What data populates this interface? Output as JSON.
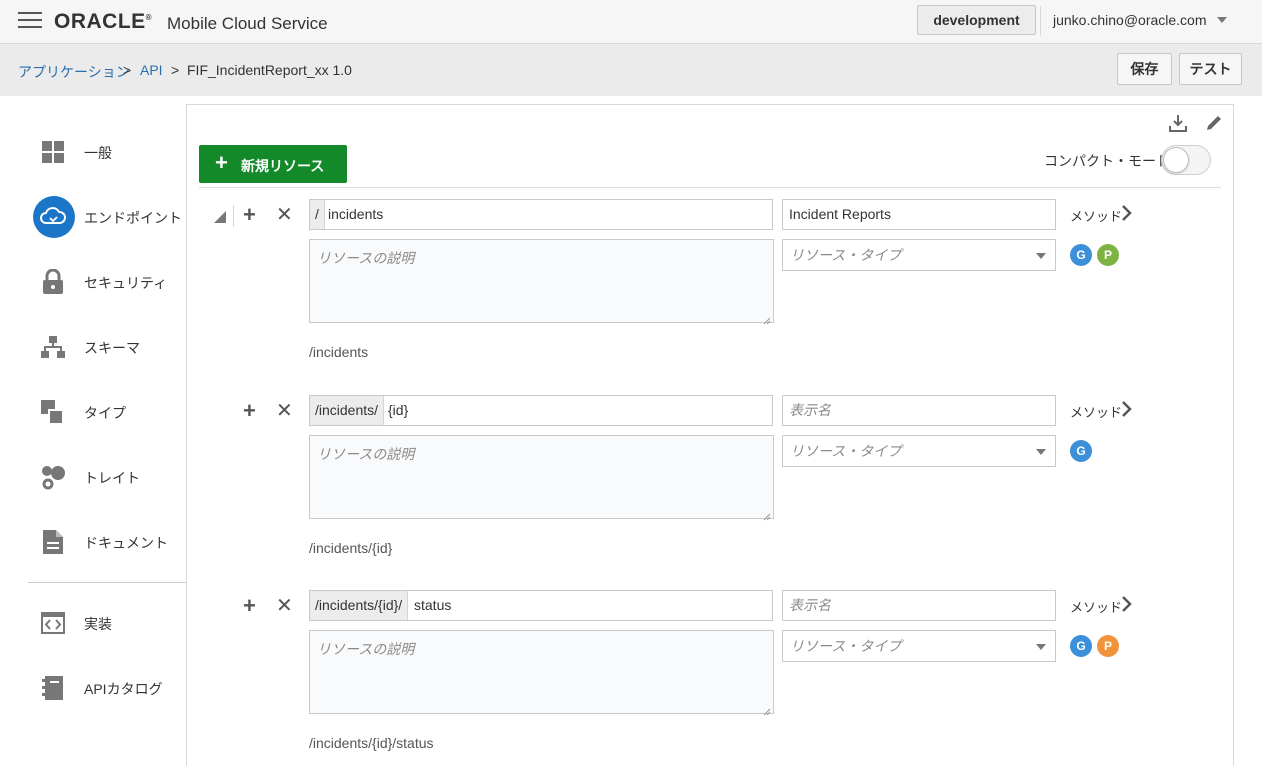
{
  "header": {
    "logo": "ORACLE",
    "product": "Mobile Cloud Service",
    "environment": "development",
    "user": "junko.chino@oracle.com"
  },
  "breadcrumb": {
    "items": [
      "アプリケーション",
      "API",
      "FIF_IncidentReport_xx 1.0"
    ],
    "separator": ">"
  },
  "actions": {
    "save": "保存",
    "test": "テスト"
  },
  "sidebar": {
    "items": [
      {
        "label": "一般",
        "icon": "grid-icon"
      },
      {
        "label": "エンドポイント",
        "icon": "cloud-endpoint-icon",
        "active": true
      },
      {
        "label": "セキュリティ",
        "icon": "lock-icon"
      },
      {
        "label": "スキーマ",
        "icon": "hierarchy-icon"
      },
      {
        "label": "タイプ",
        "icon": "types-icon"
      },
      {
        "label": "トレイト",
        "icon": "traits-icon"
      },
      {
        "label": "ドキュメント",
        "icon": "document-icon"
      },
      {
        "label": "実装",
        "icon": "code-icon"
      },
      {
        "label": "APIカタログ",
        "icon": "catalog-icon"
      }
    ]
  },
  "toolbar": {
    "new_resource": "新規リソース",
    "compact_mode": "コンパクト・モード",
    "compact_mode_on": false
  },
  "resources": [
    {
      "prefix": "/",
      "path": "incidents",
      "display_name": "Incident Reports",
      "display_name_placeholder": "表示名",
      "description_placeholder": "リソースの説明",
      "type_placeholder": "リソース・タイプ",
      "methods_label": "メソッド",
      "full_path": "/incidents",
      "method_badges": [
        {
          "letter": "G",
          "color": "#3c8fd9"
        },
        {
          "letter": "P",
          "color": "#7cb342"
        }
      ]
    },
    {
      "prefix": "/incidents/",
      "path": "{id}",
      "display_name": "",
      "display_name_placeholder": "表示名",
      "description_placeholder": "リソースの説明",
      "type_placeholder": "リソース・タイプ",
      "methods_label": "メソッド",
      "full_path": "/incidents/{id}",
      "method_badges": [
        {
          "letter": "G",
          "color": "#3c8fd9"
        }
      ]
    },
    {
      "prefix": "/incidents/{id}/",
      "path": "status",
      "display_name": "",
      "display_name_placeholder": "表示名",
      "description_placeholder": "リソースの説明",
      "type_placeholder": "リソース・タイプ",
      "methods_label": "メソッド",
      "full_path": "/incidents/{id}/status",
      "method_badges": [
        {
          "letter": "G",
          "color": "#3c8fd9"
        },
        {
          "letter": "P",
          "color": "#f0943b"
        }
      ]
    }
  ],
  "colors": {
    "accent": "#1b76c8",
    "primary_button": "#13892a",
    "link": "#2a6fb0"
  }
}
